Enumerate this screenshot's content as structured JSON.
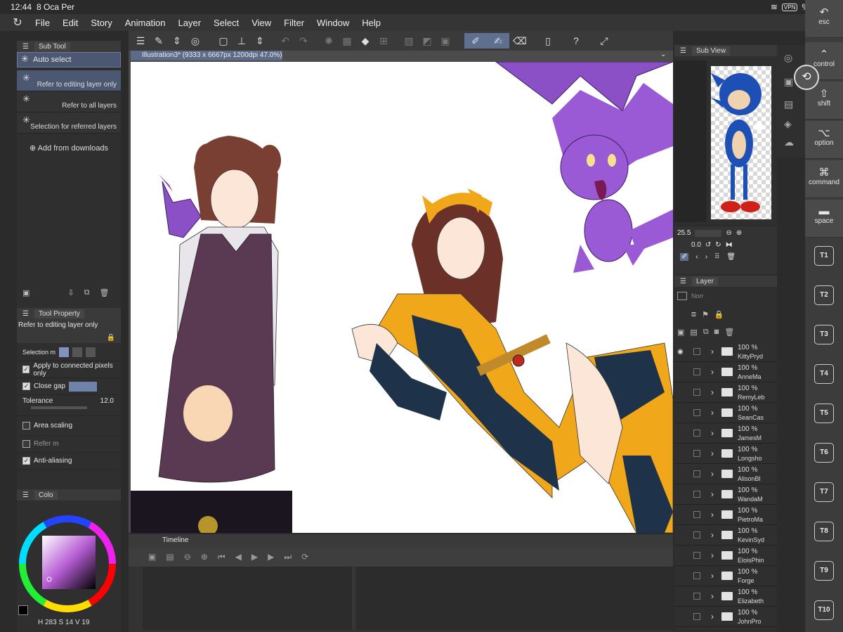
{
  "status": {
    "time": "12:44",
    "date": "8 Oca Per",
    "vpn": "VPN",
    "battery": "%13"
  },
  "menu": [
    "File",
    "Edit",
    "Story",
    "Animation",
    "Layer",
    "Select",
    "View",
    "Filter",
    "Window",
    "Help"
  ],
  "subtool": {
    "title": "Sub Tool",
    "header": "Auto select",
    "items": [
      "Refer to editing layer only",
      "Refer to all layers",
      "Selection for referred layers"
    ],
    "add": "Add from downloads"
  },
  "tool_property": {
    "title": "Tool Property",
    "current": "Refer to editing layer only",
    "selection_mode": "Selection m",
    "apply_connected": "Apply to connected pixels only",
    "close_gap": "Close gap",
    "tolerance_label": "Tolerance",
    "tolerance_value": "12.0",
    "area_scaling": "Area scaling",
    "refer": "Refer m",
    "antialias": "Anti-aliasing"
  },
  "color": {
    "tab": "Colo",
    "hsv": "H 283 S 14 V 19",
    "h": "283",
    "s": "14",
    "v": "19"
  },
  "document": {
    "tab": "Illustration3* (9333 x 6667px 1200dpi 47.0%)"
  },
  "timeline": {
    "title": "Timeline"
  },
  "subview": {
    "title": "Sub View"
  },
  "navigator": {
    "zoom": "25.5",
    "rotate": "0.0"
  },
  "layers": {
    "title": "Layer",
    "blend": "Norr",
    "rows": [
      {
        "pct": "100 %",
        "name": "KittyPryd"
      },
      {
        "pct": "100 %",
        "name": "AnneMa"
      },
      {
        "pct": "100 %",
        "name": "RemyLeb"
      },
      {
        "pct": "100 %",
        "name": "SeanCas"
      },
      {
        "pct": "100 %",
        "name": "JamesM"
      },
      {
        "pct": "100 %",
        "name": "Longsho"
      },
      {
        "pct": "100 %",
        "name": "AlisonBl"
      },
      {
        "pct": "100 %",
        "name": "WandaM"
      },
      {
        "pct": "100 %",
        "name": "PietroMa"
      },
      {
        "pct": "100 %",
        "name": "KevinSyd"
      },
      {
        "pct": "100 %",
        "name": "EloisPhin"
      },
      {
        "pct": "100 %",
        "name": "Forge"
      },
      {
        "pct": "100 %",
        "name": "Elizabeth"
      },
      {
        "pct": "100 %",
        "name": "JohnPro"
      }
    ]
  },
  "keys": {
    "esc": "esc",
    "control": "control",
    "shift": "shift",
    "option": "option",
    "command": "command",
    "space": "space",
    "tkeys": [
      "T1",
      "T2",
      "T3",
      "T4",
      "T5",
      "T6",
      "T7",
      "T8",
      "T9",
      "T10"
    ]
  },
  "colors": {
    "accent": "#5f6f90",
    "purple": "#8b4fc6",
    "yellow": "#f0a81a",
    "navy": "#1e3349",
    "dress": "#5a3a52"
  }
}
